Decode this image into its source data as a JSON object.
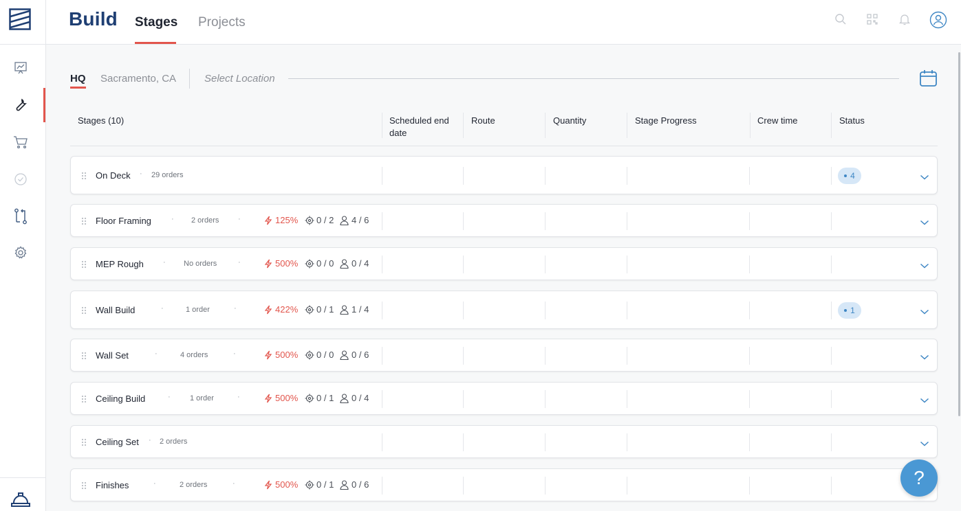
{
  "header": {
    "app_title": "Build",
    "tabs": [
      {
        "label": "Stages",
        "active": true
      },
      {
        "label": "Projects",
        "active": false
      }
    ]
  },
  "locations": {
    "tabs": [
      {
        "label": "HQ",
        "active": true
      },
      {
        "label": "Sacramento, CA",
        "active": false
      }
    ],
    "select_placeholder": "Select Location"
  },
  "table": {
    "columns": [
      "Stages (10)",
      "Scheduled end date",
      "Route",
      "Quantity",
      "Stage Progress",
      "Crew time",
      "Status"
    ]
  },
  "stages": [
    {
      "name": "On Deck",
      "orders": "29 orders",
      "perf": "",
      "routes": "",
      "crew": "",
      "status_count": "4"
    },
    {
      "name": "Floor Framing",
      "orders": "2 orders",
      "perf": "125%",
      "routes": "0 / 2",
      "crew": "4 / 6",
      "status_count": ""
    },
    {
      "name": "MEP Rough",
      "orders": "No orders",
      "perf": "500%",
      "routes": "0 / 0",
      "crew": "0 / 4",
      "status_count": ""
    },
    {
      "name": "Wall Build",
      "orders": "1 order",
      "perf": "422%",
      "routes": "0 / 1",
      "crew": "1 / 4",
      "status_count": "1"
    },
    {
      "name": "Wall Set",
      "orders": "4 orders",
      "perf": "500%",
      "routes": "0 / 0",
      "crew": "0 / 6",
      "status_count": ""
    },
    {
      "name": "Ceiling Build",
      "orders": "1 order",
      "perf": "500%",
      "routes": "0 / 1",
      "crew": "0 / 4",
      "status_count": ""
    },
    {
      "name": "Ceiling Set",
      "orders": "2 orders",
      "perf": "",
      "routes": "",
      "crew": "",
      "status_count": ""
    },
    {
      "name": "Finishes",
      "orders": "2 orders",
      "perf": "500%",
      "routes": "0 / 1",
      "crew": "0 / 6",
      "status_count": ""
    }
  ],
  "help": {
    "label": "?"
  },
  "colors": {
    "brand": "#1f3f73",
    "accent": "#e2554c",
    "status": "#3e86c4",
    "help": "#4a98d4"
  }
}
